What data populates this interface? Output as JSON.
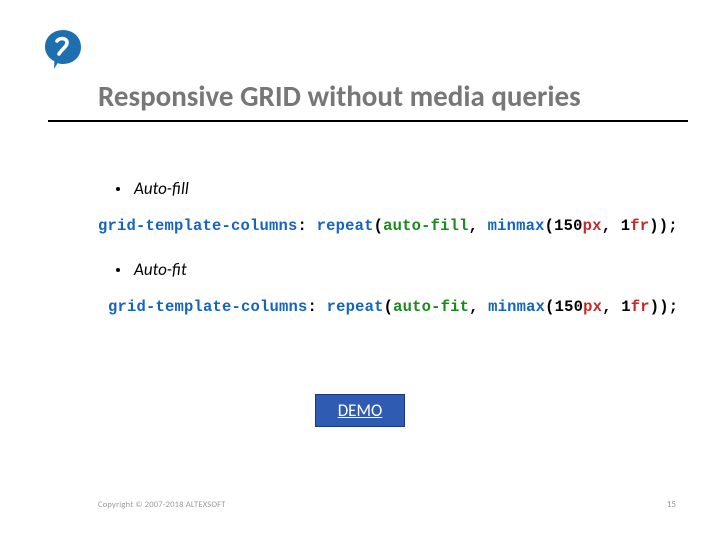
{
  "title": "Responsive GRID without media queries",
  "bullets": {
    "b1": "Auto-fill",
    "b2": "Auto-fit"
  },
  "code1": {
    "prop": "grid-template-columns",
    "colon": ": ",
    "repeat": "repeat",
    "lp1": "(",
    "mode": "auto-fill",
    "comma1": ", ",
    "minmax": "minmax",
    "lp2": "(",
    "num": "150",
    "unit1": "px",
    "comma2": ", ",
    "one": "1",
    "unit2": "fr",
    "rp": "));"
  },
  "code2": {
    "prop": "grid-template-columns",
    "colon": ": ",
    "repeat": "repeat",
    "lp1": "(",
    "mode": "auto-fit",
    "comma1": ", ",
    "minmax": "minmax",
    "lp2": "(",
    "num": "150",
    "unit1": "px",
    "comma2": ", ",
    "one": "1",
    "unit2": "fr",
    "rp": "));"
  },
  "demo_label": "DEMO",
  "footer": {
    "copyright": "Copyright © 2007-2018 ALTEXSOFT",
    "page": "15"
  }
}
